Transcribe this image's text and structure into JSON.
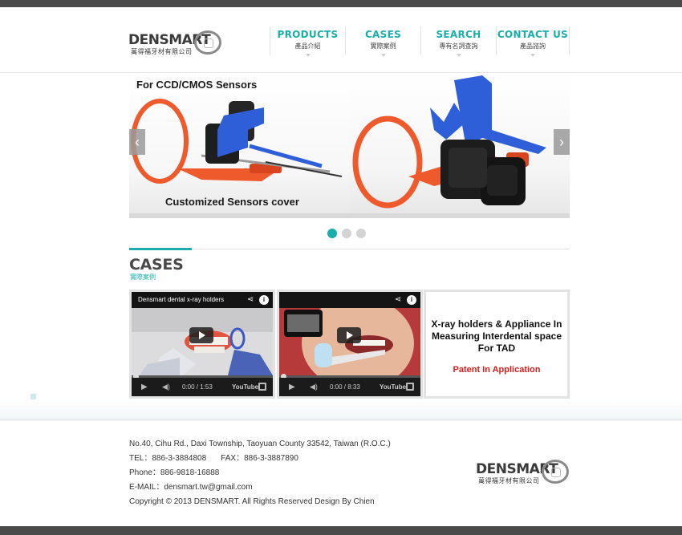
{
  "brand": {
    "name": "DENSMART",
    "subtitle": "萬得福牙材有限公司",
    "accent": "#19aeaa"
  },
  "nav": [
    {
      "label": "PRODUCTS",
      "sub": "產品介紹"
    },
    {
      "label": "CASES",
      "sub": "實際案例"
    },
    {
      "label": "SEARCH",
      "sub": "專有名詞查詢"
    },
    {
      "label": "CONTACT US",
      "sub": "產品諮詢"
    }
  ],
  "slider": {
    "heading": "For CCD/CMOS Sensors",
    "caption": "Customized Sensors cover",
    "prev_icon": "chevron-left-icon",
    "next_icon": "chevron-right-icon",
    "dots": 3,
    "active_dot": 0
  },
  "cases": {
    "title": "CASES",
    "subtitle": "實際案例",
    "videos": [
      {
        "title": "Densmart dental x-ray holders",
        "time": "0:00 / 1:53",
        "logo": "YouTube"
      },
      {
        "title": "",
        "time": "0:00 / 8:33",
        "logo": "YouTube"
      }
    ],
    "card3": {
      "line1": "X-ray holders & Appliance In",
      "line2": "Measuring Interdental space",
      "line3": "For TAD",
      "patent": "Patent In Application"
    }
  },
  "footer": {
    "address": "No.40, Cihu Rd., Daxi Township, Taoyuan County 33542, Taiwan (R.O.C.)",
    "tel": "TEL：886-3-3884808",
    "fax": "FAX：886-3-3887890",
    "phone": "Phone：886-9818-16888",
    "email": "E-MAIL：densmart.tw@gmail.com",
    "copyright": "Copyright © 2013 DENSMART. All Rights Reserved Design By Chien"
  }
}
